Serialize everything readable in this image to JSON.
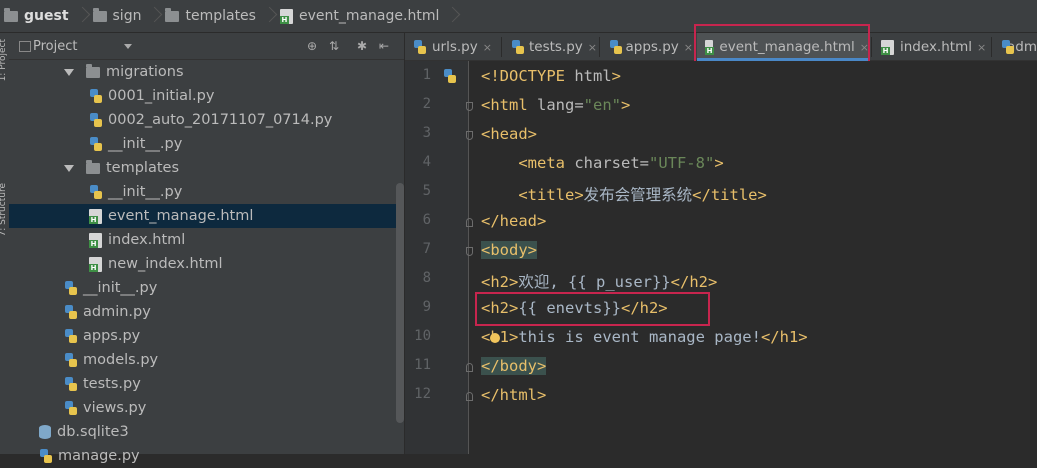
{
  "breadcrumb": {
    "items": [
      "guest",
      "sign",
      "templates",
      "event_manage.html"
    ]
  },
  "sidebar": {
    "title": "Project",
    "stripe_labels": [
      "1: Project",
      "7: Structure"
    ]
  },
  "tree": [
    {
      "label": "migrations",
      "type": "folder",
      "expanded": true
    },
    {
      "label": "0001_initial.py",
      "type": "py"
    },
    {
      "label": "0002_auto_20171107_0714.py",
      "type": "py"
    },
    {
      "label": "__init__.py",
      "type": "py"
    },
    {
      "label": "templates",
      "type": "folder",
      "expanded": true
    },
    {
      "label": "__init__.py",
      "type": "py"
    },
    {
      "label": "event_manage.html",
      "type": "html",
      "selected": true
    },
    {
      "label": "index.html",
      "type": "html"
    },
    {
      "label": "new_index.html",
      "type": "html"
    },
    {
      "label": "__init__.py",
      "type": "py"
    },
    {
      "label": "admin.py",
      "type": "py"
    },
    {
      "label": "apps.py",
      "type": "py"
    },
    {
      "label": "models.py",
      "type": "py"
    },
    {
      "label": "tests.py",
      "type": "py"
    },
    {
      "label": "views.py",
      "type": "py"
    },
    {
      "label": "db.sqlite3",
      "type": "db"
    },
    {
      "label": "manage.py",
      "type": "py"
    }
  ],
  "tabs": [
    {
      "label": "urls.py",
      "close": "×"
    },
    {
      "label": "tests.py",
      "close": "×"
    },
    {
      "label": "apps.py",
      "close": "×"
    },
    {
      "label": "event_manage.html",
      "close": "×",
      "active": true
    },
    {
      "label": "index.html",
      "close": "×"
    },
    {
      "label": "adm",
      "close": ""
    }
  ],
  "editor": {
    "line_numbers": [
      "1",
      "2",
      "3",
      "4",
      "5",
      "6",
      "7",
      "8",
      "9",
      "10",
      "11",
      "12"
    ],
    "lines": [
      [
        [
          "tag",
          "<!DOCTYPE "
        ],
        [
          "attr",
          "html"
        ],
        [
          "tag",
          ">"
        ]
      ],
      [
        [
          "tag",
          "<html "
        ],
        [
          "attr",
          "lang="
        ],
        [
          "str",
          "\"en\""
        ],
        [
          "tag",
          ">"
        ]
      ],
      [
        [
          "tag",
          "<head>"
        ]
      ],
      [
        [
          "txt",
          "    "
        ],
        [
          "tag",
          "<meta "
        ],
        [
          "attr",
          "charset="
        ],
        [
          "str",
          "\"UTF-8\""
        ],
        [
          "tag",
          ">"
        ]
      ],
      [
        [
          "txt",
          "    "
        ],
        [
          "tag",
          "<title>"
        ],
        [
          "txt",
          "发布会管理系统"
        ],
        [
          "tag",
          "</title>"
        ]
      ],
      [
        [
          "tag",
          "</head>"
        ]
      ],
      [
        [
          "hl",
          "<body>"
        ]
      ],
      [
        [
          "tag",
          "<h2>"
        ],
        [
          "txt",
          "欢迎, {{ p_user}}"
        ],
        [
          "tag",
          "</h2>"
        ]
      ],
      [
        [
          "tag",
          "<h2>"
        ],
        [
          "txt",
          "{{ enevts}}"
        ],
        [
          "tag",
          "</h2>"
        ]
      ],
      [
        [
          "tag",
          "<h1>"
        ],
        [
          "txt",
          "this is event manage page!"
        ],
        [
          "tag",
          "</h1>"
        ]
      ],
      [
        [
          "hl",
          "</body>"
        ]
      ],
      [
        [
          "tag",
          "</html>"
        ]
      ]
    ]
  },
  "colors": {
    "highlight_box": "#c7254e",
    "active_tab_underline": "#4a88c7"
  }
}
